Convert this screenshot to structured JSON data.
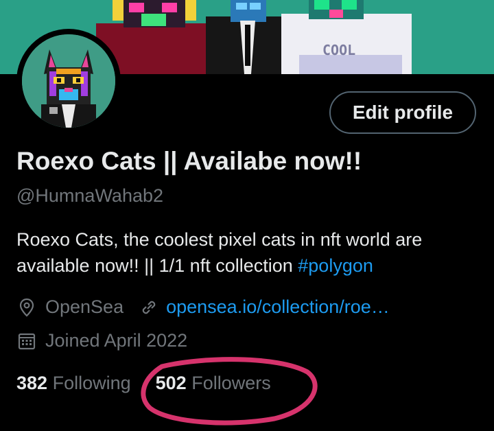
{
  "profile": {
    "name": "Roexo Cats || Availabe now!!",
    "handle": "@HumnaWahab2",
    "bio_text": "Roexo Cats, the coolest pixel cats in nft world are available now!! || 1/1 nft collection ",
    "bio_hashtag": "#polygon",
    "location": "OpenSea",
    "website": "opensea.io/collection/roe…",
    "joined": "Joined April 2022",
    "following_count": "382",
    "following_label": "Following",
    "followers_count": "502",
    "followers_label": "Followers"
  },
  "actions": {
    "edit_profile_label": "Edit profile"
  },
  "banner": {
    "shirt_text": "COOL"
  },
  "icons": {
    "location": "location-pin-icon",
    "link": "link-icon",
    "calendar": "calendar-icon"
  },
  "colors": {
    "background": "#000000",
    "primary_text": "#e7e9ea",
    "secondary_text": "#71767b",
    "link": "#1d9bf0",
    "button_border": "#536471",
    "highlight_circle": "#d6336c",
    "banner_bg": "#2aa087"
  }
}
